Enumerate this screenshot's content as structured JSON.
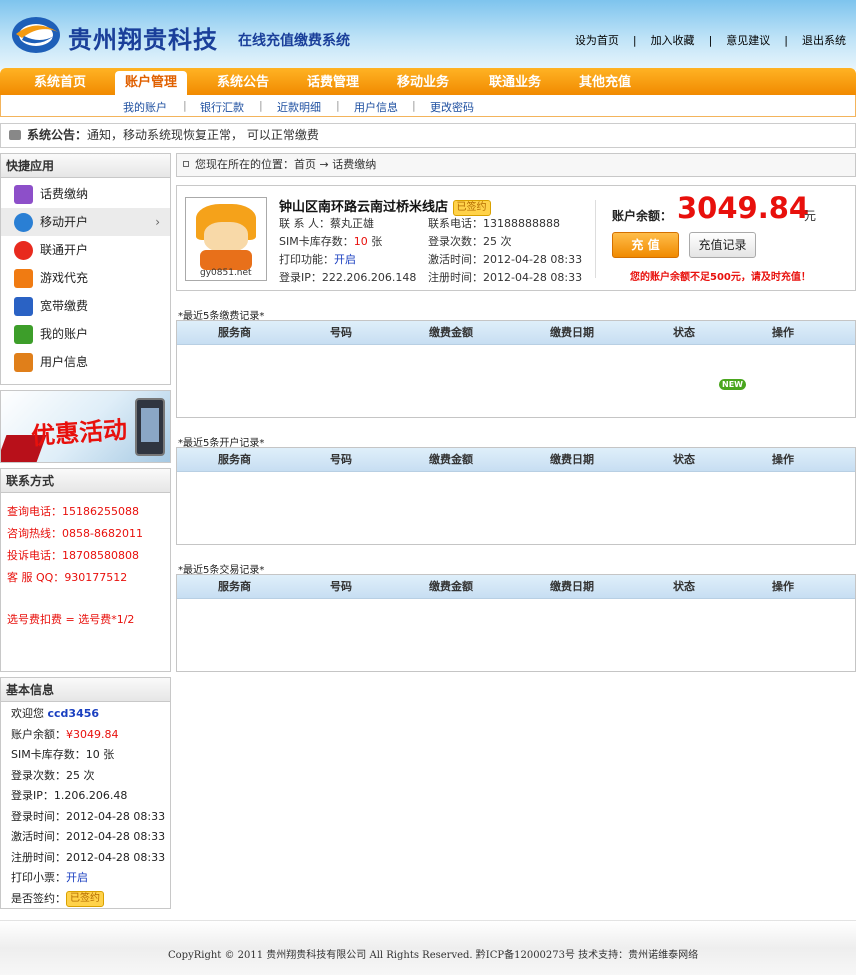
{
  "header": {
    "logo_title": "贵州翔贵科技",
    "logo_subtitle": "在线充值缴费系统",
    "top_links": [
      "设为首页",
      "加入收藏",
      "意见建议",
      "退出系统"
    ]
  },
  "nav": {
    "items": [
      "系统首页",
      "账户管理",
      "系统公告",
      "话费管理",
      "移动业务",
      "联通业务",
      "其他充值"
    ],
    "active": "账户管理"
  },
  "subnav": {
    "items": [
      "我的账户",
      "银行汇款",
      "近款明细",
      "用户信息",
      "更改密码"
    ]
  },
  "notice": {
    "label": "系统公告：",
    "text": "通知，移动系统现恢复正常， 可以正常缴费"
  },
  "quick": {
    "title": "快捷应用",
    "items": [
      {
        "label": "话费缴纳",
        "icon": "phone-icon",
        "color": "#8d4fc9"
      },
      {
        "label": "移动开户",
        "icon": "mobile-logo-icon",
        "color": "#2a7fd4"
      },
      {
        "label": "联通开户",
        "icon": "unicom-logo-icon",
        "color": "#e82a1e"
      },
      {
        "label": "游戏代充",
        "icon": "game-icon",
        "color": "#f07b12"
      },
      {
        "label": "宽带缴费",
        "icon": "broadband-icon",
        "color": "#2a62c4"
      },
      {
        "label": "我的账户",
        "icon": "account-icon",
        "color": "#3d9e2a"
      },
      {
        "label": "用户信息",
        "icon": "user-info-icon",
        "color": "#e07f1a"
      }
    ]
  },
  "promo": {
    "text": "优惠活动"
  },
  "contact": {
    "title": "联系方式",
    "lines": [
      {
        "label": "查询电话：",
        "value": "15186255088"
      },
      {
        "label": "咨询热线：",
        "value": "0858-8682011"
      },
      {
        "label": "投诉电话：",
        "value": "18708580808"
      },
      {
        "label": "客 服 QQ：",
        "value": "930177512"
      }
    ],
    "fee_note": "选号费扣费 = 选号费*1/2"
  },
  "basic": {
    "title": "基本信息",
    "welcome_label": "欢迎您",
    "username": "ccd3456",
    "balance_label": "账户余额：",
    "balance_value": "¥3049.84",
    "sim_label": "SIM卡库存数：",
    "sim_value": "10 张",
    "login_count_label": "登录次数：",
    "login_count_value": "25 次",
    "ip_label": "登录IP：",
    "ip_value": "1.206.206.48",
    "login_time_label": "登录时间：",
    "login_time_value": "2012-04-28 08:33",
    "activate_time_label": "激活时间：",
    "activate_time_value": "2012-04-28 08:33",
    "register_time_label": "注册时间：",
    "register_time_value": "2012-04-28 08:33",
    "print_label": "打印小票：",
    "print_value": "开启",
    "sign_label": "是否签约：",
    "sign_value": "已签约"
  },
  "breadcrumb": {
    "prefix": "您现在所在的位置：",
    "home": "首页",
    "arrow": "→",
    "current": "话费缴纳"
  },
  "account": {
    "shop_name": "钟山区南环路云南过桥米线店",
    "sign_badge": "已签约",
    "avatar_tag": "gy0851.net",
    "contact_person_label": "联 系 人：",
    "contact_person": "蔡丸正雄",
    "contact_phone_label": "联系电话：",
    "contact_phone": "13188888888",
    "sim_label": "SIM卡库存数：",
    "sim_value": "10",
    "sim_unit": "张",
    "login_count_label": "登录次数：",
    "login_count": "25 次",
    "print_label": "打印功能：",
    "print_value": "开启",
    "activate_label": "激活时间：",
    "activate_value": "2012-04-28 08:33",
    "ip_label": "登录IP：",
    "ip_value": "222.206.206.148",
    "register_label": "注册时间：",
    "register_value": "2012-04-28 08:33",
    "balance_label": "账户余额：",
    "balance_value": "3049.84",
    "balance_unit": "元",
    "recharge_button": "充 值",
    "history_button": "充值记录",
    "warning": "您的账户余额不足500元，请及时充值！"
  },
  "tables": [
    {
      "title": "*最近5条缴费记录*",
      "columns": [
        "服务商",
        "号码",
        "缴费金额",
        "缴费日期",
        "状态",
        "操作"
      ]
    },
    {
      "title": "*最近5条开户记录*",
      "columns": [
        "服务商",
        "号码",
        "缴费金额",
        "缴费日期",
        "状态",
        "操作"
      ]
    },
    {
      "title": "*最近5条交易记录*",
      "columns": [
        "服务商",
        "号码",
        "缴费金额",
        "缴费日期",
        "状态",
        "操作"
      ]
    }
  ],
  "new_badge": "NEW",
  "footer": {
    "text": "CopyRight © 2011 贵州翔贵科技有限公司 All Rights Reserved.  黔ICP备12000273号  技术支持：贵州诺维泰网络"
  }
}
